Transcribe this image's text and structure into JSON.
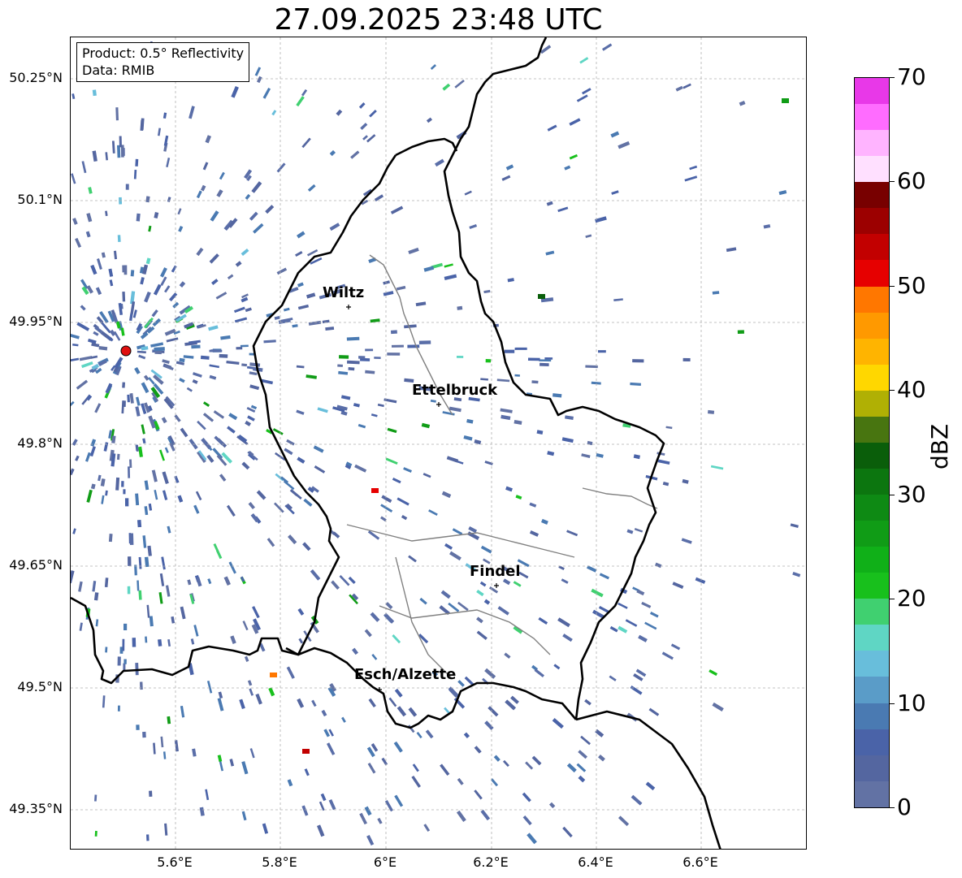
{
  "title": "27.09.2025 23:48 UTC",
  "info": {
    "product": "Product: 0.5° Reflectivity",
    "data": "Data: RMIB"
  },
  "lat_labels": [
    "50.25°N",
    "50.1°N",
    "49.95°N",
    "49.8°N",
    "49.65°N",
    "49.5°N",
    "49.35°N"
  ],
  "lon_labels": [
    "5.6°E",
    "5.8°E",
    "6°E",
    "6.2°E",
    "6.4°E",
    "6.6°E"
  ],
  "cities": [
    "Wiltz",
    "Ettelbruck",
    "Findel",
    "Esch/Alzette"
  ],
  "colorbar": {
    "unit": "dBZ",
    "ticks": [
      "0",
      "10",
      "20",
      "30",
      "40",
      "50",
      "60",
      "70"
    ],
    "colors": [
      "#6272a4",
      "#5466a0",
      "#4a63a8",
      "#4a7ab2",
      "#5a9cc8",
      "#68bedb",
      "#5fd6c4",
      "#40d070",
      "#18c01c",
      "#10b018",
      "#109c16",
      "#0e8a14",
      "#0c760f",
      "#0a5e0a",
      "#487510",
      "#b0b004",
      "#ffd700",
      "#ffb400",
      "#ff9900",
      "#ff7700",
      "#e60000",
      "#c20000",
      "#9c0000",
      "#780000",
      "#ffe0ff",
      "#ffb4ff",
      "#ff6cff",
      "#e838e8"
    ]
  },
  "radar_site": "red-marker"
}
